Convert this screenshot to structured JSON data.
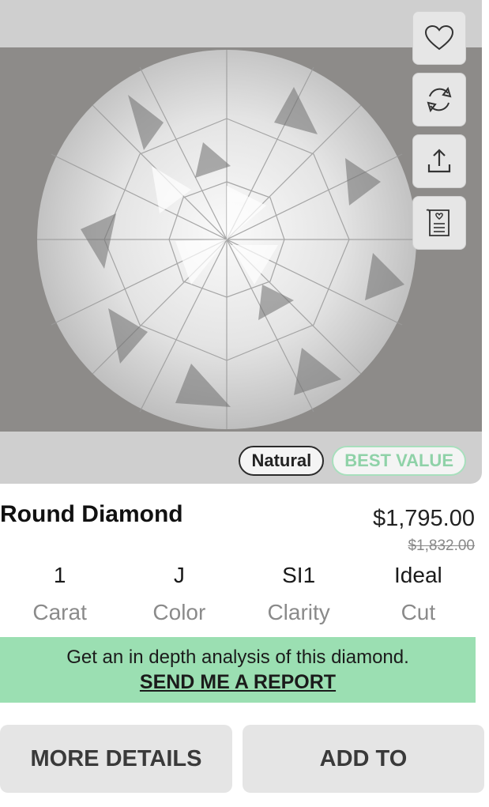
{
  "product": {
    "title": "Round Diamond",
    "price": "$1,795.00",
    "old_price": "$1,832.00",
    "badges": {
      "natural": "Natural",
      "best_value": "BEST VALUE"
    }
  },
  "specs": [
    {
      "value": "1",
      "label": "Carat"
    },
    {
      "value": "J",
      "label": "Color"
    },
    {
      "value": "SI1",
      "label": "Clarity"
    },
    {
      "value": "Ideal",
      "label": "Cut"
    }
  ],
  "report": {
    "text": "Get an in depth analysis of this diamond.",
    "link": "SEND ME A REPORT"
  },
  "buttons": {
    "more_details": "MORE DETAILS",
    "add_to": "ADD TO"
  },
  "icons": [
    "heart-icon",
    "compare-icon",
    "share-icon",
    "certificate-icon"
  ],
  "colors": {
    "accent_green": "#9bdfb2",
    "badge_green": "#8fd2a8",
    "button_bg": "#e5e5e5"
  }
}
